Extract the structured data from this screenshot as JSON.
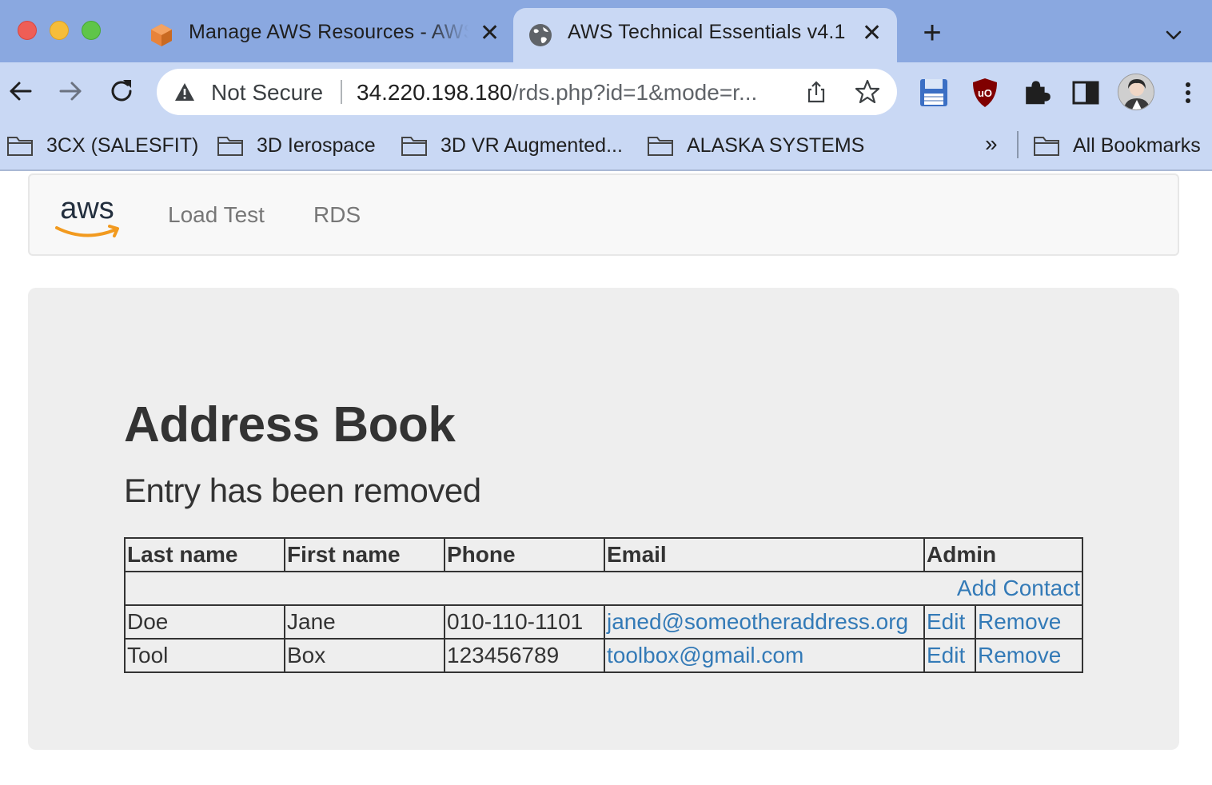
{
  "browser": {
    "tabs": [
      {
        "title": "Manage AWS Resources - AWS",
        "icon": "aws-cube-icon",
        "active": false
      },
      {
        "title": "AWS Technical Essentials v4.1",
        "icon": "globe-icon",
        "active": true
      }
    ],
    "new_tab": "+",
    "security_label": "Not Secure",
    "url_host": "34.220.198.180",
    "url_path": "/rds.php?id=1&mode=r...",
    "bookmarks": [
      {
        "label": "3CX (SALESFIT)"
      },
      {
        "label": "3D Ierospace"
      },
      {
        "label": "3D VR Augmented..."
      },
      {
        "label": "ALASKA SYSTEMS"
      }
    ],
    "bookmarks_overflow": "»",
    "all_bookmarks": "All Bookmarks",
    "colors": {
      "tabstrip": "#8aa8e0",
      "toolbar": "#c9d8f4"
    }
  },
  "navbar": {
    "logo_text": "aws",
    "links": [
      "Load Test",
      "RDS"
    ]
  },
  "main": {
    "title": "Address Book",
    "status": "Entry has been removed",
    "table": {
      "headers": [
        "Last name",
        "First name",
        "Phone",
        "Email",
        "Admin"
      ],
      "add_contact": "Add Contact",
      "rows": [
        {
          "last": "Doe",
          "first": "Jane",
          "phone": "010-110-1101",
          "email": "janed@someotheraddress.org",
          "edit": "Edit",
          "remove": "Remove"
        },
        {
          "last": "Tool",
          "first": "Box",
          "phone": "123456789",
          "email": "toolbox@gmail.com",
          "edit": "Edit",
          "remove": "Remove"
        }
      ]
    },
    "colors": {
      "link": "#337ab7",
      "jumbotron": "#eeeeee",
      "text": "#333333"
    }
  }
}
